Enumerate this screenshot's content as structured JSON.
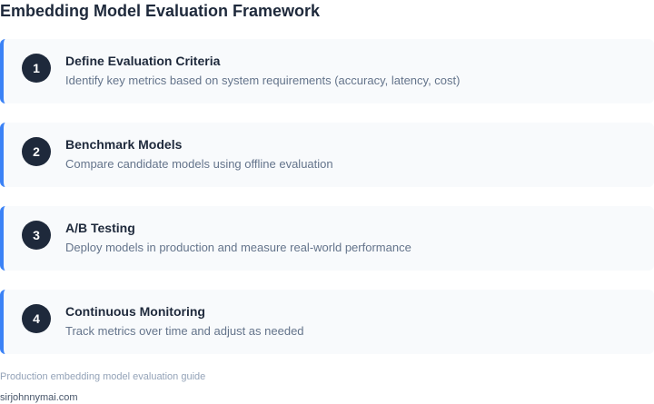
{
  "title": "Embedding Model Evaluation Framework",
  "steps": [
    {
      "number": "1",
      "title": "Define Evaluation Criteria",
      "description": "Identify key metrics based on system requirements (accuracy, latency, cost)"
    },
    {
      "number": "2",
      "title": "Benchmark Models",
      "description": "Compare candidate models using offline evaluation"
    },
    {
      "number": "3",
      "title": "A/B Testing",
      "description": "Deploy models in production and measure real-world performance"
    },
    {
      "number": "4",
      "title": "Continuous Monitoring",
      "description": "Track metrics over time and adjust as needed"
    }
  ],
  "caption": "Production embedding model evaluation guide",
  "source": "sirjohnnymai.com",
  "colors": {
    "accent": "#3b82f6",
    "badge": "#1e293b",
    "card_background": "#f8fafc"
  }
}
